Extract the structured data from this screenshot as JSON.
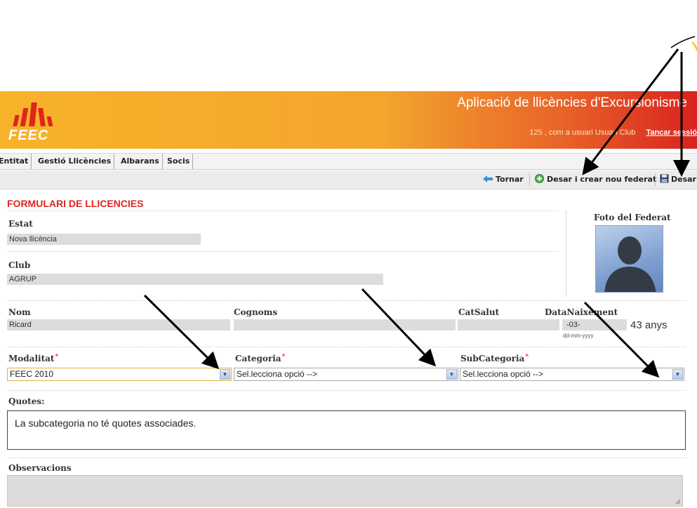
{
  "header": {
    "logo_text": "FEEC",
    "app_title": "Aplicació de llicències d'Excursionisme",
    "user_info": "125 , com a usuari Usuari Club",
    "logout_label": "Tancar sessió",
    "colors": {
      "gradient_start": "#f7b32a",
      "gradient_end": "#d8231e",
      "logo_red": "#e2231c"
    }
  },
  "nav": {
    "tabs": [
      "Entitat",
      "Gestió Llicències",
      "Albarans",
      "Socis"
    ]
  },
  "toolbar": {
    "back_label": "Tornar",
    "save_new_label": "Desar i crear nou federat",
    "save_label": "Desar",
    "icons": [
      "arrow-left-icon",
      "add-circle-icon",
      "floppy-disk-icon"
    ]
  },
  "form": {
    "title": "FORMULARI DE LLICENCIES",
    "title_color": "#e0251e",
    "estat": {
      "label": "Estat",
      "value": "Nova llicència"
    },
    "club": {
      "label": "Club",
      "value": "AGRUP"
    },
    "photo": {
      "label": "Foto del Federat"
    },
    "nom": {
      "label": "Nom",
      "value": "Ricard"
    },
    "cognoms": {
      "label": "Cognoms",
      "value": ""
    },
    "catsalut": {
      "label": "CatSalut",
      "value": ""
    },
    "data_naixement": {
      "label": "DataNaixement",
      "value": "-03-",
      "format_hint": "dd-mm-yyyy",
      "age": "43 anys"
    },
    "modalitat": {
      "label": "Modalitat",
      "required_mark": "*",
      "value": "FEEC 2010"
    },
    "categoria": {
      "label": "Categoria",
      "required_mark": "*",
      "value": "Sel.lecciona opció -->"
    },
    "subcategoria": {
      "label": "SubCategoria",
      "required_mark": "*",
      "value": "Sel.lecciona opció -->"
    },
    "quotes": {
      "label": "Quotes:",
      "message": "La subcategoria no té quotes associades."
    },
    "observacions": {
      "label": "Observacions",
      "value": ""
    }
  }
}
